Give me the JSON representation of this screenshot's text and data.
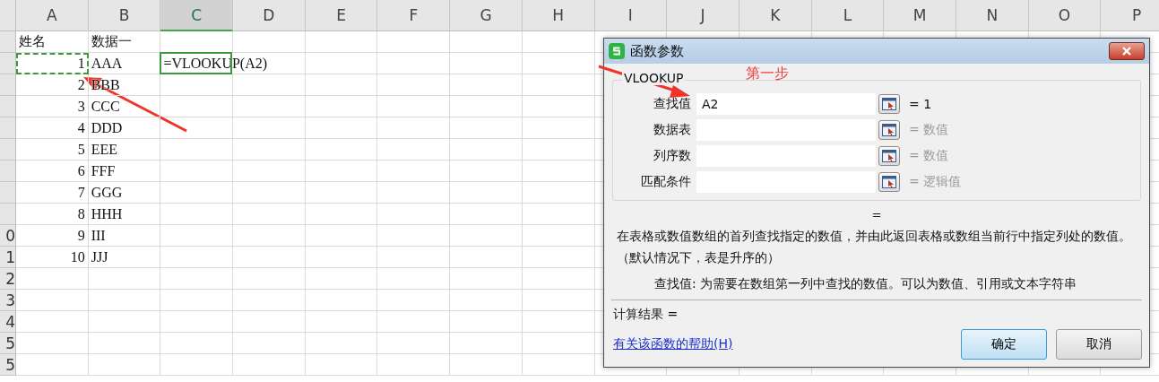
{
  "sheet": {
    "columns": [
      {
        "label": "A",
        "selected": false
      },
      {
        "label": "B",
        "selected": false
      },
      {
        "label": "C",
        "selected": true
      },
      {
        "label": "D",
        "selected": false
      },
      {
        "label": "E",
        "selected": false
      },
      {
        "label": "F",
        "selected": false
      },
      {
        "label": "G",
        "selected": false
      },
      {
        "label": "H",
        "selected": false
      },
      {
        "label": "I",
        "selected": false
      },
      {
        "label": "J",
        "selected": false
      },
      {
        "label": "K",
        "selected": false
      },
      {
        "label": "L",
        "selected": false
      },
      {
        "label": "M",
        "selected": false
      },
      {
        "label": "N",
        "selected": false
      },
      {
        "label": "O",
        "selected": false
      },
      {
        "label": "P",
        "selected": false
      }
    ],
    "rows": [
      {
        "cells": [
          {
            "text": "姓名",
            "kind": "text"
          },
          {
            "text": "数据一",
            "kind": "text"
          },
          null
        ]
      },
      {
        "cells": [
          {
            "text": "1",
            "kind": "number",
            "marquee": true
          },
          {
            "text": "AAA",
            "kind": "text"
          },
          {
            "text": "=VLOOKUP(A2)",
            "kind": "text",
            "active": true
          }
        ]
      },
      {
        "cells": [
          {
            "text": "2",
            "kind": "number"
          },
          {
            "text": "BBB",
            "kind": "text"
          },
          null
        ]
      },
      {
        "cells": [
          {
            "text": "3",
            "kind": "number"
          },
          {
            "text": "CCC",
            "kind": "text"
          },
          null
        ]
      },
      {
        "cells": [
          {
            "text": "4",
            "kind": "number"
          },
          {
            "text": "DDD",
            "kind": "text"
          },
          null
        ]
      },
      {
        "cells": [
          {
            "text": "5",
            "kind": "number"
          },
          {
            "text": "EEE",
            "kind": "text"
          },
          null
        ]
      },
      {
        "cells": [
          {
            "text": "6",
            "kind": "number"
          },
          {
            "text": "FFF",
            "kind": "text"
          },
          null
        ]
      },
      {
        "cells": [
          {
            "text": "7",
            "kind": "number"
          },
          {
            "text": "GGG",
            "kind": "text"
          },
          null
        ]
      },
      {
        "cells": [
          {
            "text": "8",
            "kind": "number"
          },
          {
            "text": "HHH",
            "kind": "text"
          },
          null
        ]
      },
      {
        "label": "0",
        "cells": [
          {
            "text": "9",
            "kind": "number"
          },
          {
            "text": "III",
            "kind": "text"
          },
          null
        ]
      },
      {
        "label": "1",
        "cells": [
          {
            "text": "10",
            "kind": "number"
          },
          {
            "text": "JJJ",
            "kind": "text"
          },
          null
        ]
      },
      {
        "label": "2",
        "cells": [
          null,
          null,
          null
        ]
      },
      {
        "label": "3",
        "cells": [
          null,
          null,
          null
        ]
      },
      {
        "label": "4",
        "cells": [
          null,
          null,
          null
        ]
      },
      {
        "label": "5",
        "cells": [
          null,
          null,
          null
        ]
      },
      {
        "label": "5",
        "cells": [
          null,
          null,
          null
        ]
      }
    ]
  },
  "annotation": {
    "text": "第一步"
  },
  "dialog": {
    "title": "函数参数",
    "function_name": "VLOOKUP",
    "arguments": [
      {
        "label": "查找值",
        "value": "A2",
        "result": "= 1",
        "muted": false
      },
      {
        "label": "数据表",
        "result": "= 数值",
        "muted": true
      },
      {
        "label": "列序数",
        "result": "= 数值",
        "muted": true
      },
      {
        "label": "匹配条件",
        "result": "= 逻辑值",
        "muted": true
      }
    ],
    "formula_result": "=",
    "description": "在表格或数值数组的首列查找指定的数值，并由此返回表格或数组当前行中指定列处的数值。（默认情况下，表是升序的）",
    "argument_help": "查找值:  为需要在数组第一列中查找的数值。可以为数值、引用或文本字符串",
    "calc_result": "计算结果 =",
    "help_link": "有关该函数的帮助(H)",
    "buttons": [
      {
        "label": "确定",
        "primary": true
      },
      {
        "label": "取消",
        "primary": false
      }
    ]
  }
}
